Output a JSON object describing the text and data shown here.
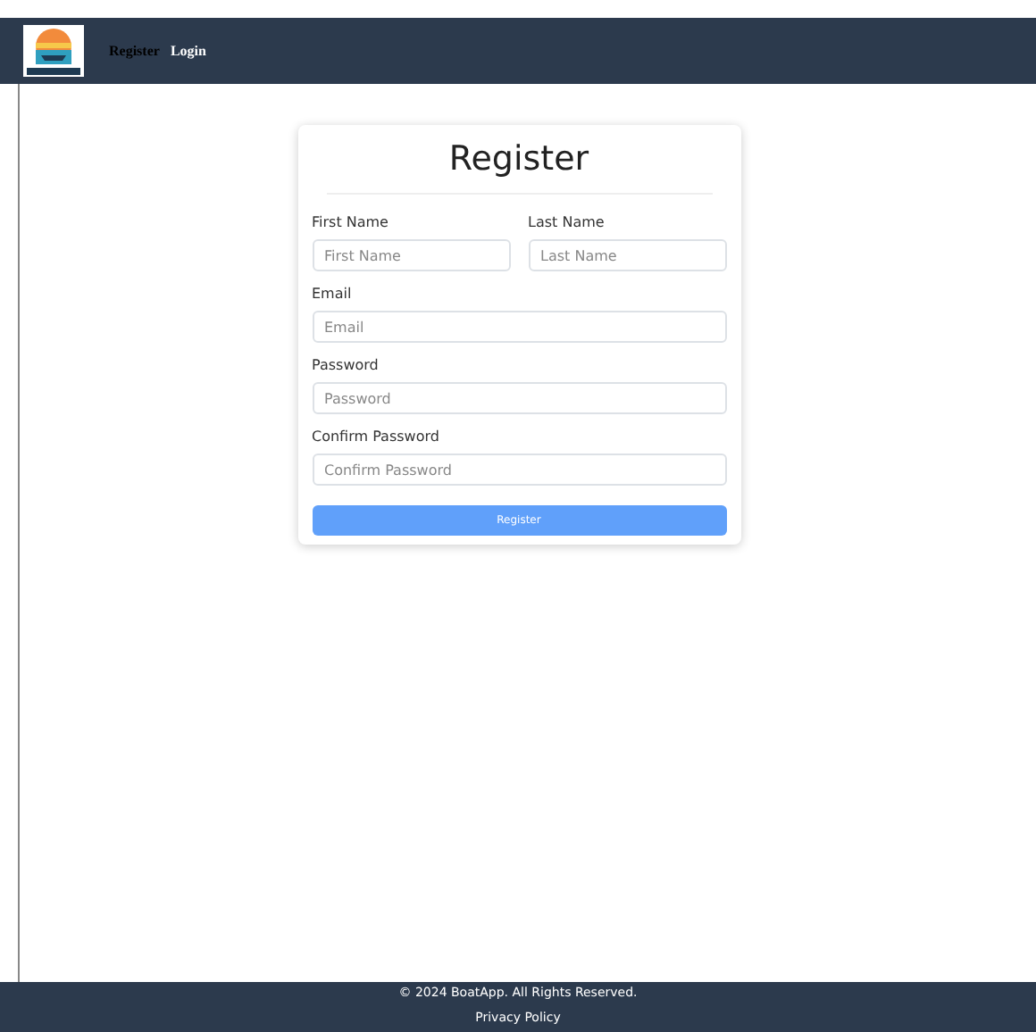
{
  "nav": {
    "links": [
      {
        "label": "Register",
        "selected": true
      },
      {
        "label": "Login",
        "selected": false
      }
    ]
  },
  "form": {
    "title": "Register",
    "name_fields": [
      {
        "label": "First Name",
        "placeholder": "First Name"
      },
      {
        "label": "Last Name",
        "placeholder": "Last Name"
      }
    ],
    "fields": [
      {
        "label": "Email",
        "placeholder": "Email"
      },
      {
        "label": "Password",
        "placeholder": "Password"
      },
      {
        "label": "Confirm Password",
        "placeholder": "Confirm Password"
      }
    ],
    "submit": "Register"
  },
  "footer": {
    "copyright": "© 2024 BoatApp. All Rights Reserved.",
    "link": "Privacy Policy"
  }
}
